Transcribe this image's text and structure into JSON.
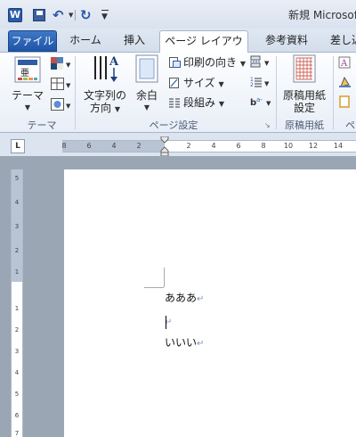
{
  "titlebar": {
    "app_icon": "W",
    "title": "新規 Microsoft"
  },
  "tabs": [
    {
      "label": "ファイル"
    },
    {
      "label": "ホーム"
    },
    {
      "label": "挿入"
    },
    {
      "label": "ページ レイアウト",
      "active": true
    },
    {
      "label": "参考資料"
    },
    {
      "label": "差し込"
    }
  ],
  "ribbon": {
    "theme_group": {
      "label": "テーマ",
      "button": "テーマ"
    },
    "page_setup_group": {
      "label": "ページ設定",
      "text_direction": "文字列の\n方向",
      "text_direction_l1": "文字列の",
      "text_direction_l2": "方向",
      "margins": "余白",
      "orientation": "印刷の向き",
      "size": "サイズ",
      "columns": "段組み"
    },
    "genko_group": {
      "label": "原稿用紙",
      "button_l1": "原稿用紙",
      "button_l2": "設定"
    },
    "overflow_label": "ペ"
  },
  "ruler": {
    "tab_selector": "L",
    "horizontal_ticks": [
      "8",
      "6",
      "4",
      "2",
      "2",
      "4",
      "6",
      "8",
      "10",
      "12",
      "14"
    ],
    "vertical_ticks": [
      "5",
      "4",
      "3",
      "2",
      "1",
      "1",
      "2",
      "3",
      "4",
      "5",
      "6",
      "7"
    ]
  },
  "document": {
    "lines": [
      "あああ",
      "",
      "いいい"
    ],
    "paragraph_mark": "↵"
  },
  "colors": {
    "file_tab": "#2a5ba8",
    "ribbon_bg": "#f3f6fb",
    "workspace_bg": "#9ba6b5"
  }
}
